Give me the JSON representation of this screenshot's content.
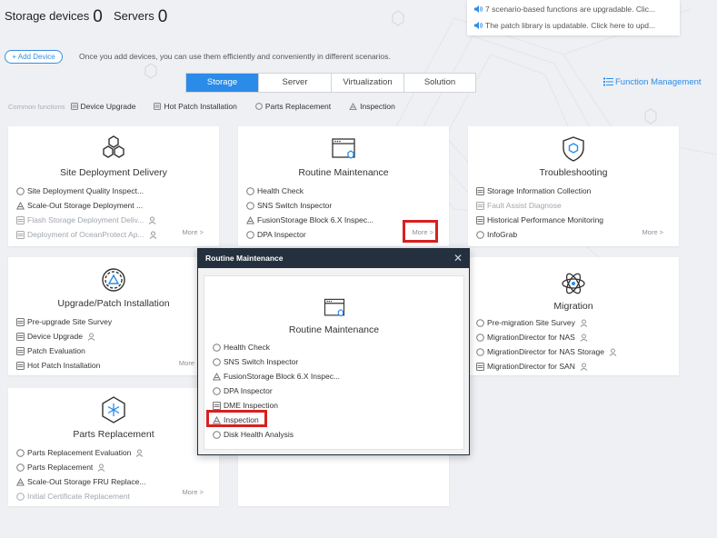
{
  "header": {
    "storage_label": "Storage devices",
    "storage_count": "0",
    "servers_label": "Servers",
    "servers_count": "0"
  },
  "notices": [
    "7 scenario-based functions are upgradable. Clic...",
    "The patch library is updatable. Click here to upd..."
  ],
  "add_device": {
    "label": "+ Add Device",
    "hint": "Once you add devices, you can use them efficiently and conveniently in different scenarios."
  },
  "tabs": [
    "Storage",
    "Server",
    "Virtualization",
    "Solution"
  ],
  "function_management": "Function Management",
  "common_functions": {
    "label": "Common functions",
    "items": [
      "Device Upgrade",
      "Hot Patch Installation",
      "Parts Replacement",
      "Inspection"
    ]
  },
  "more_label": "More >",
  "cards": {
    "site": {
      "title": "Site Deployment Delivery",
      "items": [
        "Site Deployment Quality Inspect...",
        "Scale-Out Storage Deployment ...",
        "Flash Storage Deployment Deliv...",
        "Deployment of OceanProtect Ap..."
      ]
    },
    "routine": {
      "title": "Routine Maintenance",
      "items": [
        "Health Check",
        "SNS Switch Inspector",
        "FusionStorage Block 6.X Inspec...",
        "DPA Inspector"
      ]
    },
    "trouble": {
      "title": "Troubleshooting",
      "items": [
        "Storage Information Collection",
        "Fault Assist Diagnose",
        "Historical Performance Monitoring",
        "InfoGrab"
      ]
    },
    "upgrade": {
      "title": "Upgrade/Patch Installation",
      "items": [
        "Pre-upgrade Site Survey",
        "Device Upgrade",
        "Patch Evaluation",
        "Hot Patch Installation"
      ],
      "more": "More"
    },
    "migration": {
      "title": "Migration",
      "items": [
        "Pre-migration Site Survey",
        "MigrationDirector for NAS",
        "MigrationDirector for NAS Storage",
        "MigrationDirector for SAN"
      ]
    },
    "parts": {
      "title": "Parts Replacement",
      "items": [
        "Parts Replacement Evaluation",
        "Parts Replacement",
        "Scale-Out Storage FRU Replace...",
        "Initial Certificate Replacement"
      ]
    }
  },
  "dialog": {
    "title": "Routine Maintenance",
    "close": "✕",
    "subtitle": "Routine Maintenance",
    "items": [
      "Health Check",
      "SNS Switch Inspector",
      "FusionStorage Block 6.X Inspec...",
      "DPA Inspector",
      "DME Inspection",
      "Inspection",
      "Disk Health Analysis"
    ]
  },
  "colors": {
    "accent": "#2a8ce8",
    "highlight": "#d91f1f",
    "dialog_title_bg": "#25303f"
  }
}
